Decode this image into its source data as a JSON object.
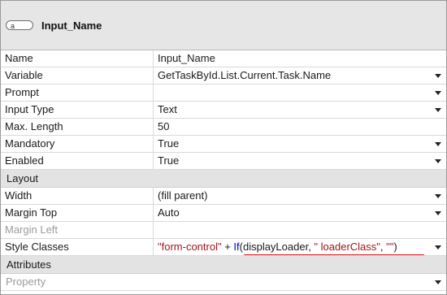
{
  "header": {
    "icon_letter": "a",
    "widget_name": "Input_Name"
  },
  "properties": [
    {
      "name": "Name",
      "value": "Input_Name",
      "dropdown": false,
      "disabled": false
    },
    {
      "name": "Variable",
      "value": "GetTaskById.List.Current.Task.Name",
      "dropdown": true,
      "disabled": false
    },
    {
      "name": "Prompt",
      "value": "",
      "dropdown": true,
      "disabled": false
    },
    {
      "name": "Input Type",
      "value": "Text",
      "dropdown": true,
      "disabled": false
    },
    {
      "name": "Max. Length",
      "value": "50",
      "dropdown": false,
      "disabled": false
    },
    {
      "name": "Mandatory",
      "value": "True",
      "dropdown": true,
      "disabled": false
    },
    {
      "name": "Enabled",
      "value": "True",
      "dropdown": true,
      "disabled": false
    }
  ],
  "layout_section": {
    "title": "Layout",
    "properties": [
      {
        "name": "Width",
        "value": "(fill parent)",
        "dropdown": true,
        "disabled": false
      },
      {
        "name": "Margin Top",
        "value": "Auto",
        "dropdown": true,
        "disabled": false
      },
      {
        "name": "Margin Left",
        "value": "",
        "dropdown": false,
        "disabled": true
      }
    ],
    "style_classes": {
      "name": "Style Classes",
      "expr_str1": "\"form-control\"",
      "expr_plus": " + ",
      "expr_kw": "If",
      "expr_open": "(displayLoader, ",
      "expr_str2": "\" loaderClass\"",
      "expr_comma": ", ",
      "expr_str3": "\"\"",
      "expr_close": ")"
    }
  },
  "attributes_section": {
    "title": "Attributes",
    "property_placeholder": "Property"
  },
  "colors": {
    "string_literal": "#a31515",
    "keyword": "#0000cc",
    "highlight_underline": "#e0141e"
  }
}
